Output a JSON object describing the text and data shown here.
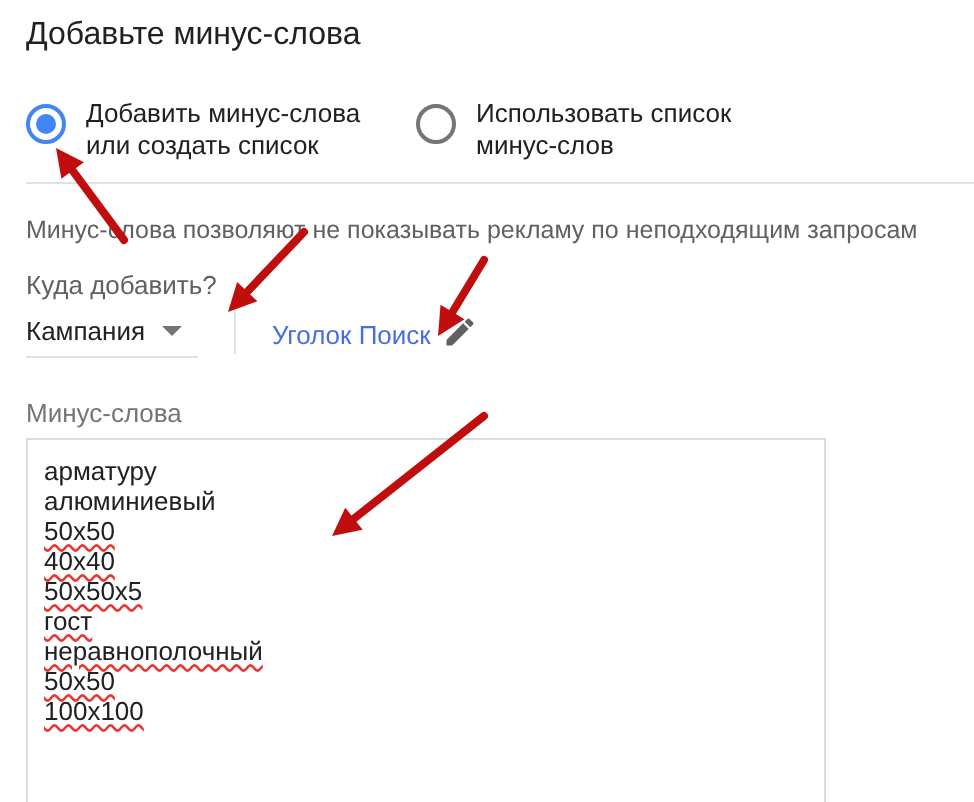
{
  "title": "Добавьте минус-слова",
  "options": [
    {
      "label": "Добавить минус-слова или создать список",
      "selected": true
    },
    {
      "label": "Использовать список минус-слов",
      "selected": false
    }
  ],
  "description": "Минус-слова позволяют не показывать рекламу по неподходящим запросам",
  "target": {
    "label": "Куда добавить?",
    "value": "Кампания",
    "campaign": "Уголок Поиск"
  },
  "keywords": {
    "label": "Минус-слова",
    "lines": [
      {
        "text": "арматуру",
        "misspelled": false
      },
      {
        "text": "алюминиевый",
        "misspelled": false
      },
      {
        "text": "50x50",
        "misspelled": true
      },
      {
        "text": "40x40",
        "misspelled": true
      },
      {
        "text": "50x50x5",
        "misspelled": true
      },
      {
        "text": "гост",
        "misspelled": true
      },
      {
        "text": "неравнополочный",
        "misspelled": true
      },
      {
        "text": "50x50",
        "misspelled": true
      },
      {
        "text": "100x100",
        "misspelled": true
      }
    ]
  }
}
